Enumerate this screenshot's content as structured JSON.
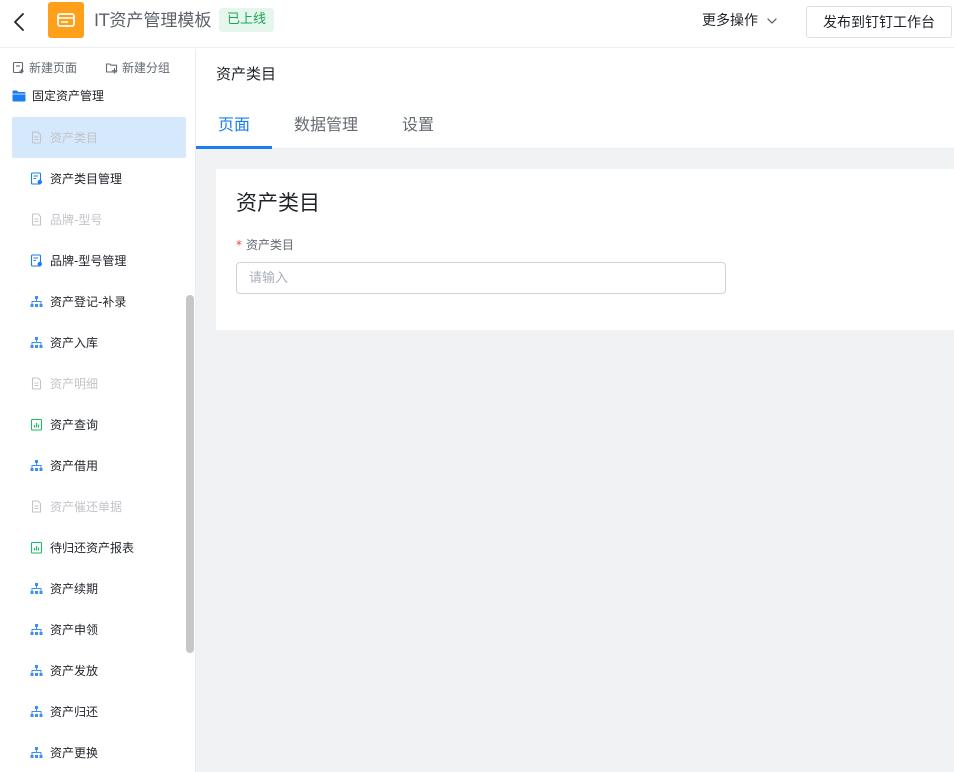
{
  "header": {
    "app_title": "IT资产管理模板",
    "status_badge": "已上线",
    "more_actions_label": "更多操作",
    "publish_label": "发布到钉钉工作台",
    "app_icon_color": "#ff9f1a"
  },
  "sidebar": {
    "new_page_label": "新建页面",
    "new_group_label": "新建分组",
    "group_title": "固定资产管理",
    "items": [
      {
        "label": "资产类目",
        "icon": "doc-icon",
        "state": "active-dim"
      },
      {
        "label": "资产类目管理",
        "icon": "form-manage-icon",
        "state": "normal"
      },
      {
        "label": "品牌-型号",
        "icon": "doc-icon",
        "state": "dim"
      },
      {
        "label": "品牌-型号管理",
        "icon": "form-manage-icon",
        "state": "normal"
      },
      {
        "label": "资产登记-补录",
        "icon": "flow-icon",
        "state": "normal"
      },
      {
        "label": "资产入库",
        "icon": "flow-icon",
        "state": "normal"
      },
      {
        "label": "资产明细",
        "icon": "doc-icon",
        "state": "dim"
      },
      {
        "label": "资产查询",
        "icon": "report-icon",
        "state": "normal"
      },
      {
        "label": "资产借用",
        "icon": "flow-icon",
        "state": "normal"
      },
      {
        "label": "资产催还单据",
        "icon": "doc-icon",
        "state": "dim"
      },
      {
        "label": "待归还资产报表",
        "icon": "report-icon",
        "state": "normal"
      },
      {
        "label": "资产续期",
        "icon": "flow-icon",
        "state": "normal"
      },
      {
        "label": "资产申领",
        "icon": "flow-icon",
        "state": "normal"
      },
      {
        "label": "资产发放",
        "icon": "flow-icon",
        "state": "normal"
      },
      {
        "label": "资产归还",
        "icon": "flow-icon",
        "state": "normal"
      },
      {
        "label": "资产更换",
        "icon": "flow-icon",
        "state": "normal"
      }
    ]
  },
  "main": {
    "page_heading": "资产类目",
    "tabs": [
      {
        "label": "页面",
        "active": true
      },
      {
        "label": "数据管理",
        "active": false
      },
      {
        "label": "设置",
        "active": false
      }
    ],
    "form": {
      "title": "资产类目",
      "field_label": "资产类目",
      "required_mark": "*",
      "input_placeholder": "请输入",
      "input_value": ""
    }
  },
  "colors": {
    "accent": "#1a7df0",
    "active_item_bg": "#d6e8fc",
    "badge_text": "#1fa356",
    "badge_bg": "#e5f7ec"
  }
}
